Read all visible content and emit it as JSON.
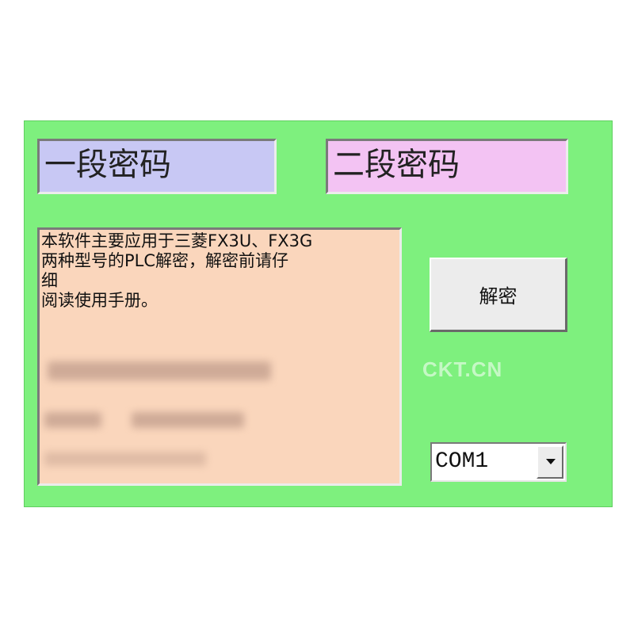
{
  "fields": {
    "password1": "一段密码",
    "password2": "二段密码"
  },
  "info": {
    "lines": [
      "本软件主要应用于三菱FX3U、FX3G",
      "两种型号的PLC解密，解密前请仔",
      "细",
      "阅读使用手册。"
    ]
  },
  "buttons": {
    "decrypt": "解密"
  },
  "port": {
    "selected": "COM1"
  },
  "watermark": "CKT.CN"
}
